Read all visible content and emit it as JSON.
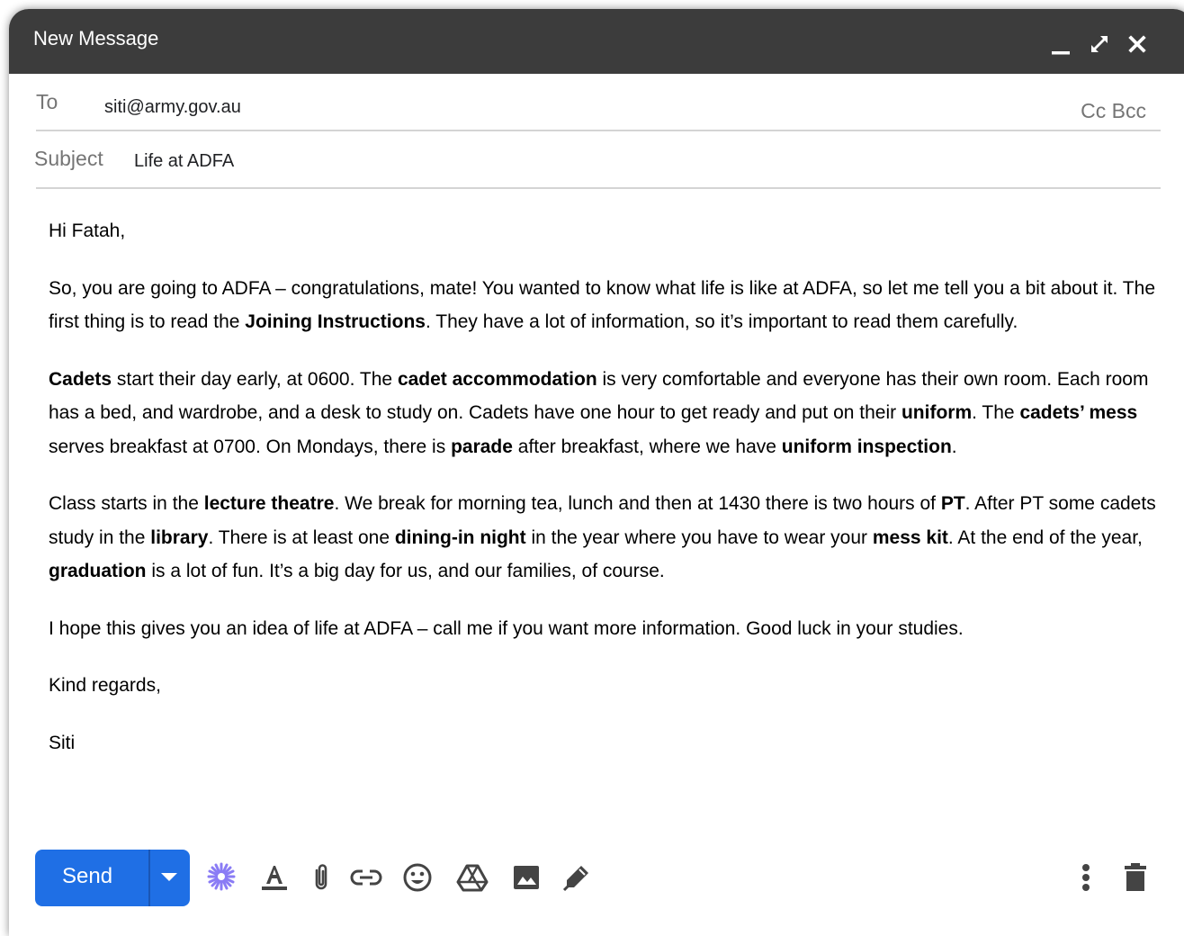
{
  "window": {
    "title": "New Message"
  },
  "to": {
    "label": "To",
    "value": "siti@army.gov.au",
    "cc_label": "Cc",
    "bcc_label": "Bcc"
  },
  "subject": {
    "label": "Subject",
    "value": "Life at ADFA"
  },
  "body": {
    "greeting": "Hi Fatah,",
    "p1": [
      "So, you are going to ADFA – congratulations, mate!  You wanted to know what life is like at ADFA, so let me tell you a bit about it. The first thing is to read the ",
      "Joining Instructions",
      ". They have a lot of information, so it’s important to read them carefully."
    ],
    "p2": [
      "Cadets",
      " start their day early, at 0600. The ",
      "cadet accommodation",
      " is very comfortable and everyone has their own room. Each room has a bed, and wardrobe, and a desk to study on. Cadets have one hour to get ready and put on their ",
      "uniform",
      ". The ",
      "cadets’ mess",
      " serves breakfast at 0700. On Mondays, there is ",
      "parade",
      " after breakfast, where we have ",
      "uniform inspection",
      "."
    ],
    "p3": [
      "Class starts in the ",
      "lecture theatre",
      ". We break for morning tea, lunch and then at 1430 there is two hours of ",
      "PT",
      ". After PT some cadets study in the ",
      "library",
      ". There is at least one ",
      "dining-in night",
      " in the year where you have to wear your ",
      "mess kit",
      ". At the end of the year, ",
      "graduation",
      " is a lot of fun. It’s a big day for us, and our families, of course."
    ],
    "p4": "I hope this gives you an idea of life at ADFA – call me if you want more information. Good luck in your studies.",
    "closing": "Kind regards,",
    "signature": "Siti"
  },
  "toolbar": {
    "send_label": "Send",
    "icons": [
      "sparkle-icon",
      "text-format-icon",
      "attach-icon",
      "link-icon",
      "emoji-icon",
      "drive-icon",
      "image-icon",
      "signature-icon",
      "more-options-icon",
      "trash-icon"
    ]
  },
  "colors": {
    "titlebar": "#3c3c3c",
    "send_button": "#1f6fe5",
    "sparkle": "#8a7cf5",
    "icon": "#444444"
  }
}
